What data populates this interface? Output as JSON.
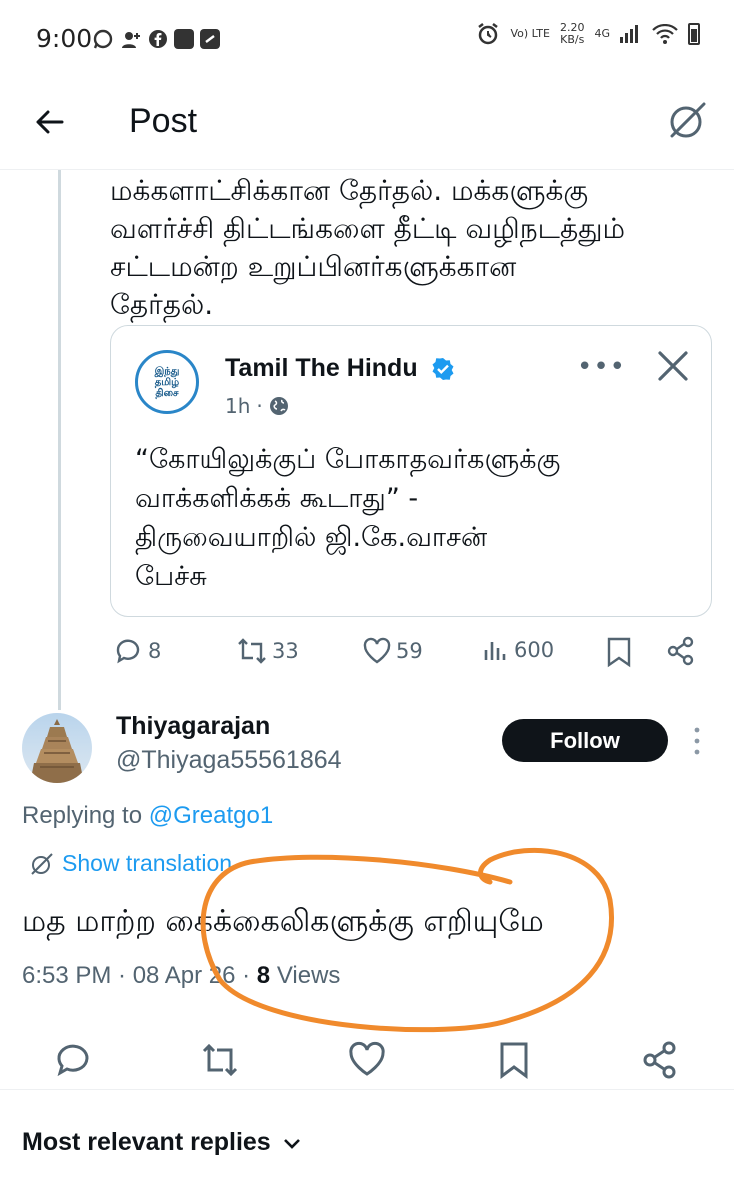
{
  "status_bar": {
    "time": "9:00",
    "network": "Vo) LTE",
    "speed_value": "2.20",
    "speed_unit": "KB/s",
    "signal": "4G"
  },
  "header": {
    "title": "Post"
  },
  "parent_tweet": {
    "text_lines": [
      "மக்களாட்சிக்கான தேர்தல். மக்களுக்கு",
      "வளர்ச்சி திட்டங்களை தீட்டி வழிநடத்தும்",
      "சட்டமன்ற உறுப்பினர்களுக்கான",
      "தேர்தல்."
    ],
    "quote": {
      "name": "Tamil The Hindu",
      "avatar_line1": "இந்து",
      "avatar_line2": "தமிழ்",
      "avatar_line3": "திசை",
      "time": "1h",
      "more": "•••",
      "text_lines": [
        "“கோயிலுக்குப் போகாதவர்களுக்கு",
        "வாக்களிக்கக் கூடாது” -",
        "திருவையாறில் ஜி.கே.வாசன்",
        "பேச்சு"
      ]
    },
    "stats": {
      "replies": "8",
      "reposts": "33",
      "likes": "59",
      "views": "600"
    }
  },
  "reply_tweet": {
    "name": "Thiyagarajan",
    "handle": "@Thiyaga55561864",
    "follow_label": "Follow",
    "replying_prefix": "Replying to ",
    "replying_mention": "@Greatgo1",
    "translate_label": "Show translation",
    "text": "மத மாற்ற கைக்கைலிகளுக்கு எறியுமே",
    "time": "6:53 PM · 08 Apr 26 · ",
    "views_count": "8",
    "views_label": " Views"
  },
  "replies_section": {
    "label": "Most relevant replies"
  },
  "colors": {
    "accent": "#1d9bf0",
    "annotation": "#f08a2c",
    "muted": "#536471"
  }
}
